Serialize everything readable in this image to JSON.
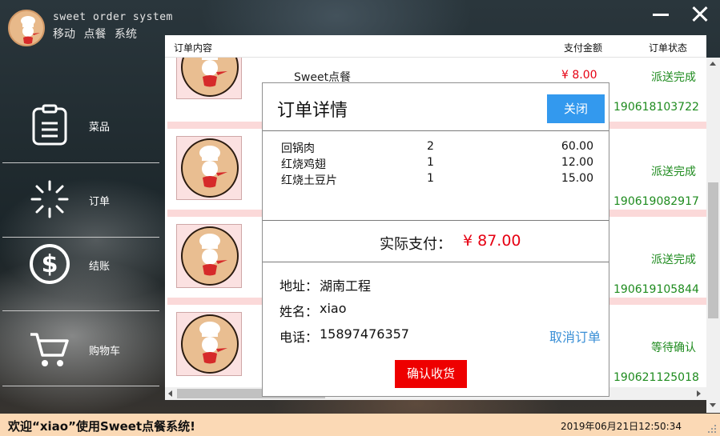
{
  "app": {
    "title_en": "sweet order system",
    "title_cn": "移动 点餐 系统"
  },
  "sidebar": {
    "items": [
      {
        "label": "菜品",
        "icon": "clipboard-icon"
      },
      {
        "label": "订单",
        "icon": "loading-spinner-icon"
      },
      {
        "label": "结账",
        "icon": "dollar-circle-icon"
      },
      {
        "label": "购物车",
        "icon": "shopping-cart-icon"
      }
    ]
  },
  "orders": {
    "columns": [
      "订单内容",
      "支付金额",
      "订单状态"
    ],
    "rows": [
      {
        "name": "Sweet点餐",
        "amount": "¥ 8.00",
        "status": "派送完成",
        "order_id": "190618103722"
      },
      {
        "name": "",
        "amount": "",
        "status": "派送完成",
        "order_id": "190619082917"
      },
      {
        "name": "",
        "amount": "",
        "status": "派送完成",
        "order_id": "190619105844"
      },
      {
        "name": "",
        "amount": "",
        "status": "等待确认",
        "order_id": "190621125018"
      }
    ]
  },
  "modal": {
    "title": "订单详情",
    "close_label": "关闭",
    "items": [
      {
        "name": "回锅肉",
        "qty": "2",
        "price": "60.00"
      },
      {
        "name": "红烧鸡翅",
        "qty": "1",
        "price": "12.00"
      },
      {
        "name": "红烧土豆片",
        "qty": "1",
        "price": "15.00"
      }
    ],
    "paid_label": "实际支付：",
    "paid_value": "¥ 87.00",
    "address_label": "地址：",
    "address_value": "湖南工程",
    "name_label": "姓名：",
    "name_value": "xiao",
    "phone_label": "电话：",
    "phone_value": "15897476357",
    "cancel_label": "取消订单",
    "confirm_label": "确认收货"
  },
  "status_bar": {
    "welcome": "欢迎“xiao”使用Sweet点餐系统!",
    "datetime": "2019年06月21日12:50:34"
  },
  "colors": {
    "accent_blue": "#3399ee",
    "status_green": "#1e8b1e",
    "price_red": "#e60012",
    "confirm_red": "#ee0000",
    "status_bar_bg": "#fbd9b5",
    "row_separator": "#fbd9d9"
  }
}
